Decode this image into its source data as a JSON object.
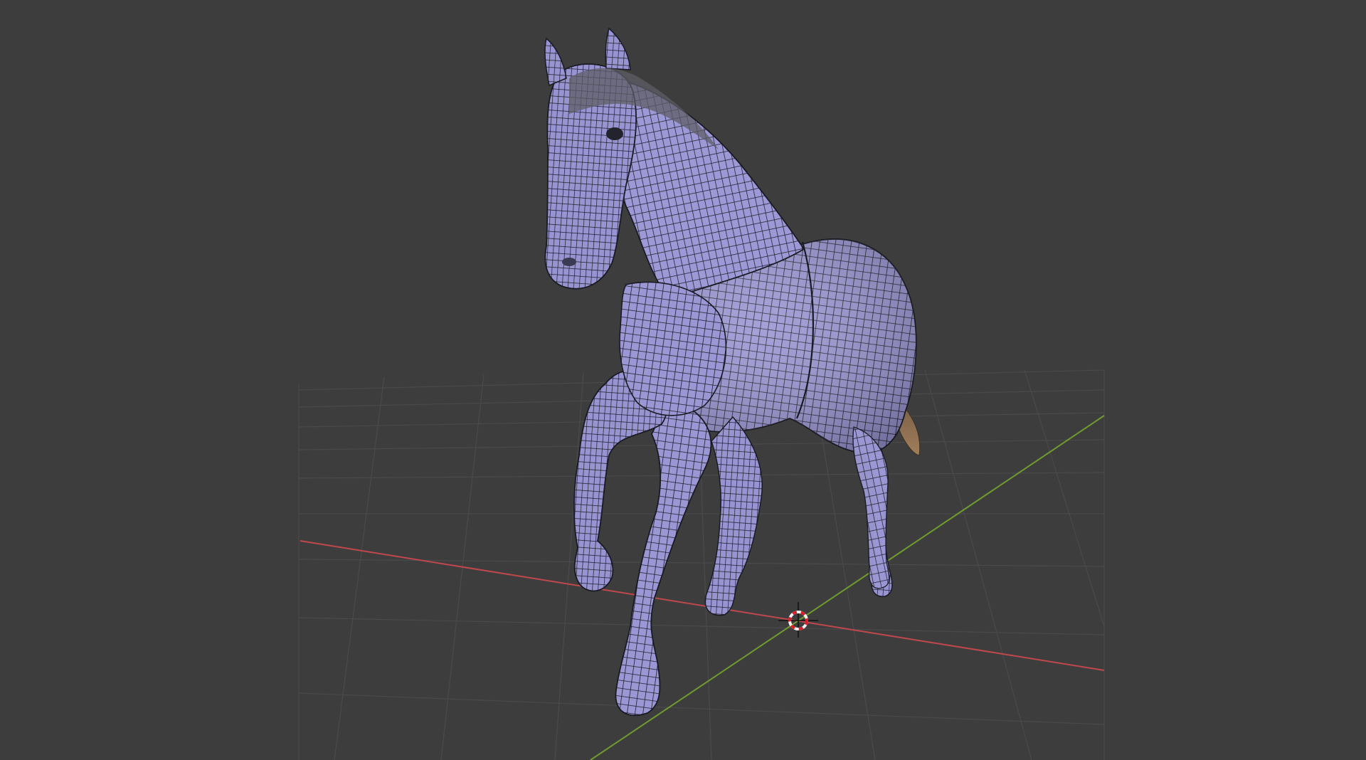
{
  "viewport": {
    "view": "3D Viewport",
    "shading": "solid-wireframe",
    "background_color": "#3d3d3d",
    "grid_color": "#4a4a4a",
    "x_axis_color": "#c0484d",
    "y_axis_color": "#6f9b2e",
    "overlays": [
      "floor-grid",
      "x-axis",
      "y-axis",
      "3d-cursor"
    ]
  },
  "model": {
    "object": "horse",
    "mesh_color": "#9b97d4",
    "wire_color": "#1a1a24",
    "mane_color": "#5a5a5a",
    "tail_color": "#8a6a48"
  },
  "cursor": {
    "icon": "3d-cursor-icon",
    "ring_colors": [
      "#d8202c",
      "#f2f2f2"
    ]
  }
}
